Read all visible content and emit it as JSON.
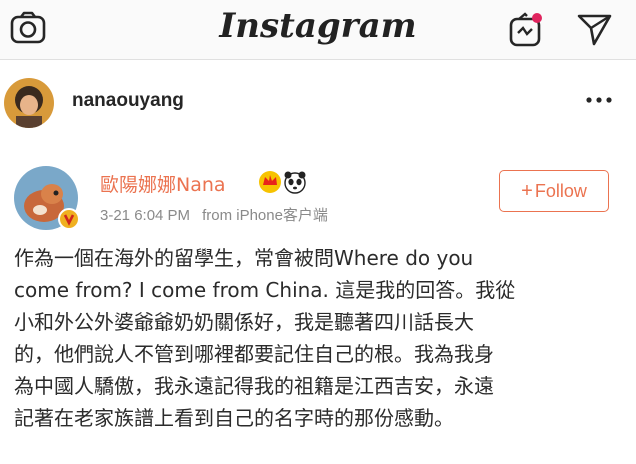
{
  "app": {
    "logo": "Instagram"
  },
  "post": {
    "username": "nanaouyang"
  },
  "weibo": {
    "name": "歐陽娜娜Nana",
    "time": "3-21 6:04 PM",
    "source": "from iPhone客户端",
    "follow_label": "Follow",
    "follow_plus": "+",
    "text_lines": [
      "作為一個在海外的留學生，常會被問Where do you",
      "come from? I come from China. 這是我的回答。我從",
      "小和外公外婆爺爺奶奶關係好，我是聽著四川話長大",
      "的，他們說人不管到哪裡都要記住自己的根。我為我身",
      "為中國人驕傲，我永遠記得我的祖籍是江西吉安，永遠",
      "記著在老家族譜上看到自己的名字時的那份感動。"
    ]
  },
  "colors": {
    "weibo_accent": "#eb7350",
    "notification_dot": "#e0245e"
  },
  "icons": {
    "camera": "camera-icon",
    "igtv": "igtv-icon",
    "direct": "paper-plane-icon",
    "more": "more-dots-icon",
    "verified": "verified-badge-icon",
    "crown": "vip-crown-icon",
    "panda": "panda-icon"
  }
}
